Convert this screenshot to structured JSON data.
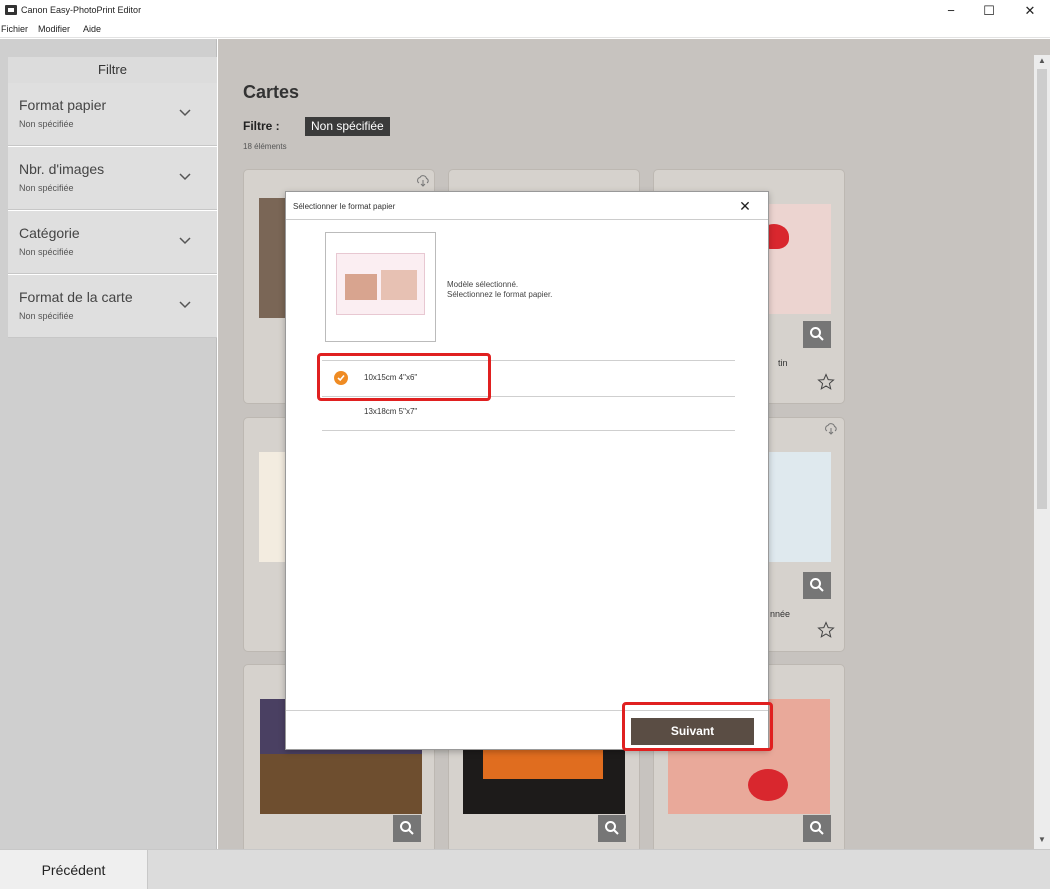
{
  "window": {
    "title": "Canon Easy-PhotoPrint Editor",
    "minimize": "−",
    "maximize": "☐",
    "close": "✕"
  },
  "menu": [
    "Fichier",
    "Modifier",
    "Aide"
  ],
  "sidebar": {
    "header": "Filtre",
    "filters": [
      {
        "label": "Format papier",
        "value": "Non spécifiée"
      },
      {
        "label": "Nbr. d'images",
        "value": "Non spécifiée"
      },
      {
        "label": "Catégorie",
        "value": "Non spécifiée"
      },
      {
        "label": "Format de la carte",
        "value": "Non spécifiée"
      }
    ]
  },
  "main": {
    "title": "Cartes",
    "filter_prefix": "Filtre :",
    "filter_chip": "Non spécifiée",
    "count": "18 éléments",
    "card_fragments": {
      "row1_right": "tin",
      "row2_right": "nnée"
    }
  },
  "modal": {
    "title": "Sélectionner le format papier",
    "close": "✕",
    "selected_line1": "Modèle sélectionné.",
    "selected_line2": "Sélectionnez le format papier.",
    "paper_sizes": [
      {
        "label": "10x15cm 4\"x6\"",
        "selected": true
      },
      {
        "label": "13x18cm 5\"x7\"",
        "selected": false
      }
    ],
    "next_button": "Suivant"
  },
  "bottom": {
    "prev_button": "Précédent"
  },
  "colors": {
    "accent_check": "#ef8b23",
    "highlight": "#e02020",
    "next_button": "#5a4d44",
    "chip": "#3b3b3b"
  },
  "icons": [
    "app-icon",
    "chevron-down-icon",
    "cloud-download-icon",
    "zoom-icon",
    "star-icon",
    "check-icon",
    "close-icon"
  ]
}
